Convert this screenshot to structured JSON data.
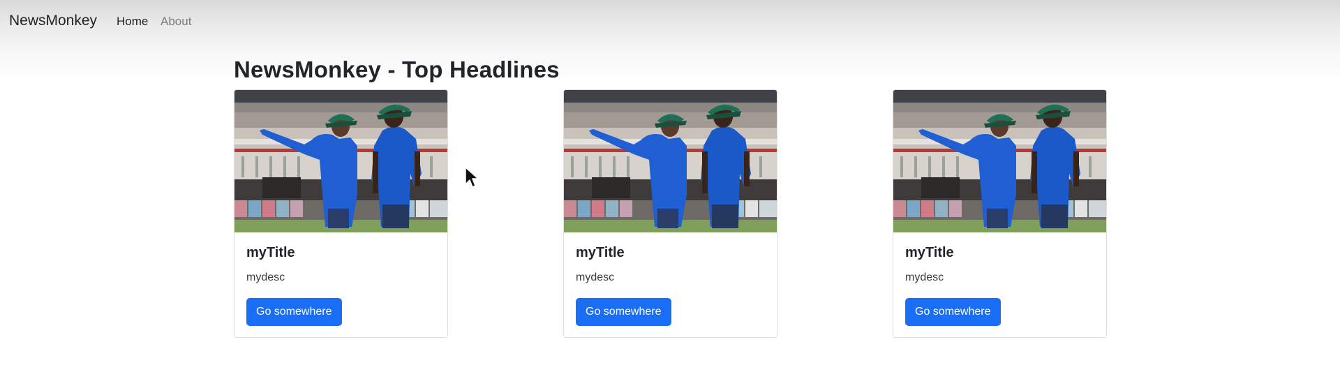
{
  "navbar": {
    "brand": "NewsMonkey",
    "links": [
      {
        "label": "Home",
        "active": true
      },
      {
        "label": "About",
        "active": false
      }
    ]
  },
  "main": {
    "heading": "NewsMonkey - Top Headlines",
    "cards": [
      {
        "title": "myTitle",
        "description": "mydesc",
        "button_label": "Go somewhere"
      },
      {
        "title": "myTitle",
        "description": "mydesc",
        "button_label": "Go somewhere"
      },
      {
        "title": "myTitle",
        "description": "mydesc",
        "button_label": "Go somewhere"
      }
    ]
  },
  "colors": {
    "primary_button": "#1a6ef5",
    "nav_inactive": "#7a7a7a"
  },
  "icons": {
    "cursor": "mouse-pointer-icon"
  }
}
